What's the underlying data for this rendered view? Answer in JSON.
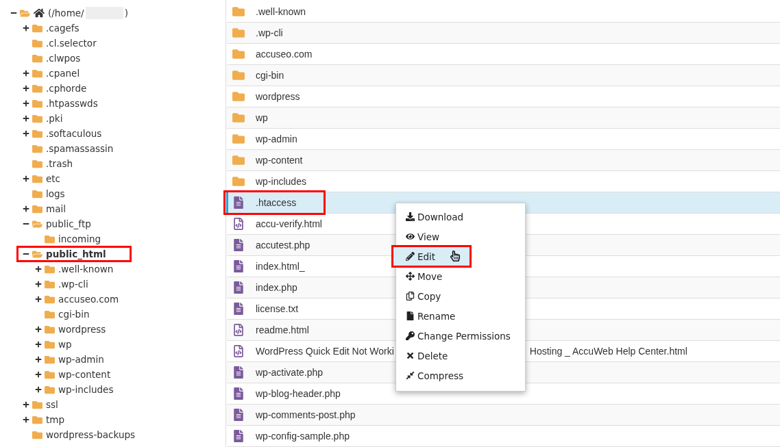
{
  "tree": {
    "root": {
      "label_start": "(/home/",
      "label_end": ")",
      "redacted": true,
      "expanded": true,
      "selected": false,
      "children": [
        {
          "label": ".cagefs",
          "expanded": false,
          "selected": false,
          "annotated": false
        },
        {
          "label": ".cl.selector",
          "selected": false,
          "annotated": false
        },
        {
          "label": ".clwpos",
          "selected": false,
          "annotated": false
        },
        {
          "label": ".cpanel",
          "expanded": false,
          "selected": false,
          "annotated": false
        },
        {
          "label": ".cphorde",
          "expanded": false,
          "selected": false,
          "annotated": false
        },
        {
          "label": ".htpasswds",
          "expanded": false,
          "selected": false,
          "annotated": false
        },
        {
          "label": ".pki",
          "expanded": false,
          "selected": false,
          "annotated": false
        },
        {
          "label": ".softaculous",
          "expanded": false,
          "selected": false,
          "annotated": false
        },
        {
          "label": ".spamassassin",
          "selected": false,
          "annotated": false
        },
        {
          "label": ".trash",
          "selected": false,
          "annotated": false
        },
        {
          "label": "etc",
          "expanded": false,
          "selected": false,
          "annotated": false
        },
        {
          "label": "logs",
          "selected": false,
          "annotated": false
        },
        {
          "label": "mail",
          "expanded": false,
          "selected": false,
          "annotated": false
        },
        {
          "label": "public_ftp",
          "expanded": true,
          "selected": false,
          "annotated": false,
          "children": [
            {
              "label": "incoming",
              "selected": false,
              "annotated": false
            }
          ]
        },
        {
          "label": "public_html",
          "expanded": true,
          "selected": true,
          "annotated": true,
          "children": [
            {
              "label": ".well-known",
              "expanded": false,
              "selected": false,
              "annotated": false
            },
            {
              "label": ".wp-cli",
              "expanded": false,
              "selected": false,
              "annotated": false
            },
            {
              "label": "accuseo.com",
              "expanded": false,
              "selected": false,
              "annotated": false
            },
            {
              "label": "cgi-bin",
              "selected": false,
              "annotated": false
            },
            {
              "label": "wordpress",
              "expanded": false,
              "selected": false,
              "annotated": false
            },
            {
              "label": "wp",
              "expanded": false,
              "selected": false,
              "annotated": false
            },
            {
              "label": "wp-admin",
              "expanded": false,
              "selected": false,
              "annotated": false
            },
            {
              "label": "wp-content",
              "expanded": false,
              "selected": false,
              "annotated": false
            },
            {
              "label": "wp-includes",
              "expanded": false,
              "selected": false,
              "annotated": false
            }
          ]
        },
        {
          "label": "ssl",
          "expanded": false,
          "selected": false,
          "annotated": false
        },
        {
          "label": "tmp",
          "expanded": false,
          "selected": false,
          "annotated": false
        },
        {
          "label": "wordpress-backups",
          "selected": false,
          "annotated": false
        }
      ]
    }
  },
  "files": [
    {
      "name": ".well-known",
      "kind": "folder",
      "selected": false,
      "annotated": false
    },
    {
      "name": ".wp-cli",
      "kind": "folder",
      "selected": false,
      "annotated": false
    },
    {
      "name": "accuseo.com",
      "kind": "folder",
      "selected": false,
      "annotated": false
    },
    {
      "name": "cgi-bin",
      "kind": "folder",
      "selected": false,
      "annotated": false
    },
    {
      "name": "wordpress",
      "kind": "folder",
      "selected": false,
      "annotated": false
    },
    {
      "name": "wp",
      "kind": "folder",
      "selected": false,
      "annotated": false
    },
    {
      "name": "wp-admin",
      "kind": "folder",
      "selected": false,
      "annotated": false
    },
    {
      "name": "wp-content",
      "kind": "folder",
      "selected": false,
      "annotated": false
    },
    {
      "name": "wp-includes",
      "kind": "folder",
      "selected": false,
      "annotated": false
    },
    {
      "name": ".htaccess",
      "kind": "text",
      "selected": true,
      "annotated": true
    },
    {
      "name": "accu-verify.html",
      "kind": "html",
      "selected": false,
      "annotated": false
    },
    {
      "name": "accutest.php",
      "kind": "text",
      "selected": false,
      "annotated": false
    },
    {
      "name": "index.html_",
      "kind": "text",
      "selected": false,
      "annotated": false
    },
    {
      "name": "index.php",
      "kind": "text",
      "selected": false,
      "annotated": false
    },
    {
      "name": "license.txt",
      "kind": "text",
      "selected": false,
      "annotated": false
    },
    {
      "name": "readme.html",
      "kind": "html",
      "selected": false,
      "annotated": false
    },
    {
      "name": "WordPress Quick Edit Not Worki",
      "name_end": "Hosting _ AccuWeb Help Center.html",
      "kind": "html",
      "selected": false,
      "annotated": false
    },
    {
      "name": "wp-activate.php",
      "kind": "text",
      "selected": false,
      "annotated": false
    },
    {
      "name": "wp-blog-header.php",
      "kind": "text",
      "selected": false,
      "annotated": false
    },
    {
      "name": "wp-comments-post.php",
      "kind": "text",
      "selected": false,
      "annotated": false
    },
    {
      "name": "wp-config-sample.php",
      "kind": "text",
      "selected": false,
      "annotated": false
    }
  ],
  "context_menu": [
    {
      "label": "Download",
      "hovered": false,
      "annotated": false
    },
    {
      "label": "View",
      "hovered": false,
      "annotated": false
    },
    {
      "label": "Edit",
      "hovered": true,
      "annotated": true
    },
    {
      "label": "Move",
      "hovered": false,
      "annotated": false
    },
    {
      "label": "Copy",
      "hovered": false,
      "annotated": false
    },
    {
      "label": "Rename",
      "hovered": false,
      "annotated": false
    },
    {
      "label": "Change Permissions",
      "hovered": false,
      "annotated": false
    },
    {
      "label": "Delete",
      "hovered": false,
      "annotated": false
    },
    {
      "label": "Compress",
      "hovered": false,
      "annotated": false
    }
  ]
}
